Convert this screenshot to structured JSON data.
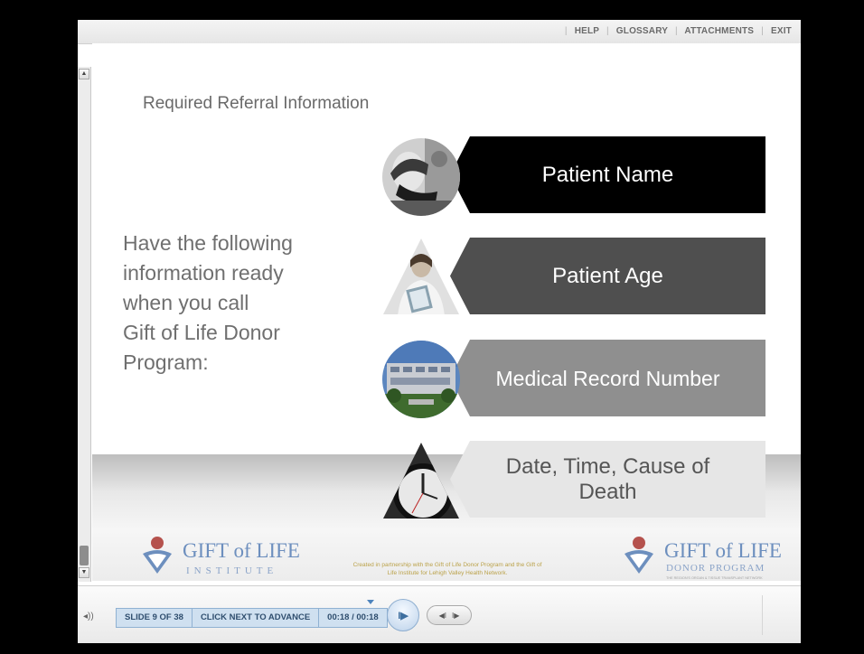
{
  "top_nav": {
    "items": [
      "HELP",
      "GLOSSARY",
      "ATTACHMENTS",
      "EXIT"
    ]
  },
  "slide": {
    "title": "Required Referral Information",
    "intro_lines": [
      "Have the following",
      "information ready",
      "when you call",
      "Gift of Life Donor",
      "Program:"
    ],
    "items": [
      {
        "label": "Patient Name",
        "photo": "doctor-on-phone-photo"
      },
      {
        "label": "Patient Age",
        "photo": "nurse-with-clipboard-photo"
      },
      {
        "label": "Medical Record Number",
        "photo": "hospital-building-photo"
      },
      {
        "label_line1": "Date, Time, Cause of",
        "label_line2": "Death",
        "photo": "clock-photo"
      }
    ],
    "logo_left": {
      "main": "GIFT of LIFE",
      "sub": "INSTITUTE"
    },
    "logo_right": {
      "main": "GIFT of LIFE",
      "sub": "DONOR PROGRAM",
      "tagline": "THE REGION'S ORGAN & TISSUE TRANSPLANT NETWORK"
    },
    "credit_line1": "Created in partnership with the Gift of Life Donor Program and the Gift of",
    "credit_line2": "Life Institute for Lehigh Valley Health Network."
  },
  "player": {
    "slide_counter": "SLIDE 9 OF 38",
    "instruction": "CLICK NEXT TO ADVANCE",
    "time": "00:18 / 00:18"
  },
  "colors": {
    "bar1": "#000000",
    "bar2": "#4f4f4f",
    "bar3": "#8f8f8f",
    "bar4": "#e6e6e6",
    "status_bg": "#cfe0f0",
    "logo_red": "#b5524d",
    "logo_blue": "#6d8fbe"
  }
}
